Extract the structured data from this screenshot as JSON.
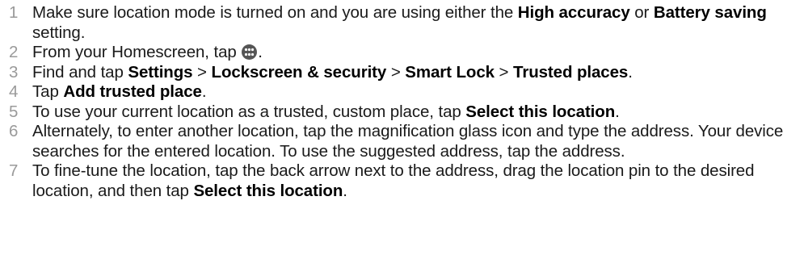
{
  "steps": [
    {
      "number": "1",
      "parts": [
        {
          "t": "Make sure location mode is turned on and you are using either the "
        },
        {
          "b": "High accuracy"
        },
        {
          "t": " or "
        },
        {
          "b": "Battery saving"
        },
        {
          "t": " setting."
        }
      ]
    },
    {
      "number": "2",
      "parts": [
        {
          "t": "From your Homescreen, tap "
        },
        {
          "icon": "apps-icon"
        },
        {
          "t": "."
        }
      ]
    },
    {
      "number": "3",
      "parts": [
        {
          "t": "Find and tap "
        },
        {
          "b": "Settings"
        },
        {
          "t": " > "
        },
        {
          "b": "Lockscreen & security"
        },
        {
          "t": " > "
        },
        {
          "b": "Smart Lock"
        },
        {
          "t": " > "
        },
        {
          "b": "Trusted places"
        },
        {
          "t": "."
        }
      ]
    },
    {
      "number": "4",
      "parts": [
        {
          "t": "Tap "
        },
        {
          "b": "Add trusted place"
        },
        {
          "t": "."
        }
      ]
    },
    {
      "number": "5",
      "parts": [
        {
          "t": "To use your current location as a trusted, custom place, tap "
        },
        {
          "b": "Select this location"
        },
        {
          "t": "."
        }
      ]
    },
    {
      "number": "6",
      "parts": [
        {
          "t": "Alternately, to enter another location, tap the magnification glass icon and type the address. Your device searches for the entered location. To use the suggested address, tap the address."
        }
      ]
    },
    {
      "number": "7",
      "parts": [
        {
          "t": "To fine-tune the location, tap the back arrow next to the address, drag the location pin to the desired location, and then tap "
        },
        {
          "b": "Select this location"
        },
        {
          "t": "."
        }
      ]
    }
  ]
}
